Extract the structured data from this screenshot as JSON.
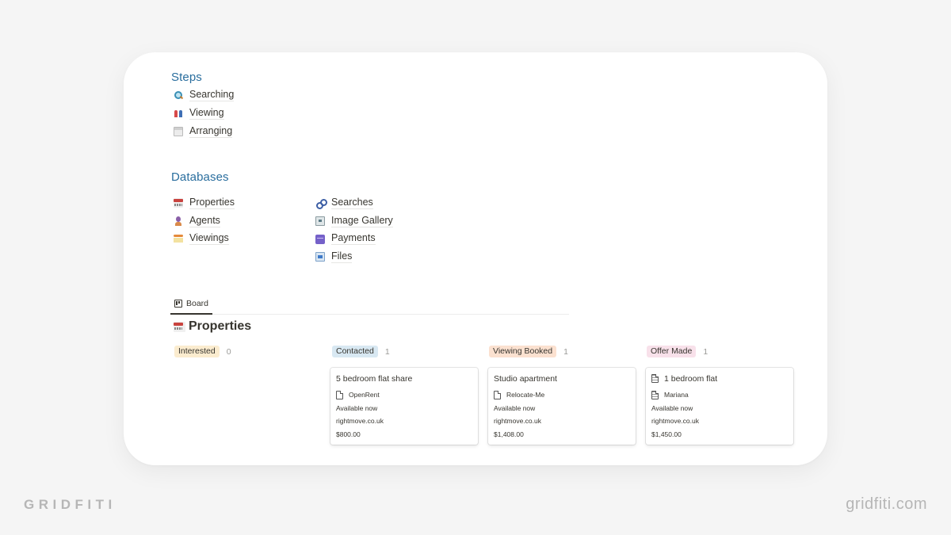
{
  "steps": {
    "heading": "Steps",
    "items": [
      {
        "label": "Searching",
        "icon": "magnifying-glass-icon"
      },
      {
        "label": "Viewing",
        "icon": "people-icon"
      },
      {
        "label": "Arranging",
        "icon": "calendar-icon"
      }
    ]
  },
  "databases": {
    "heading": "Databases",
    "left": [
      {
        "label": "Properties",
        "icon": "properties-icon"
      },
      {
        "label": "Agents",
        "icon": "agent-icon"
      },
      {
        "label": "Viewings",
        "icon": "viewings-icon"
      }
    ],
    "right": [
      {
        "label": "Searches",
        "icon": "link-icon"
      },
      {
        "label": "Image Gallery",
        "icon": "gallery-icon"
      },
      {
        "label": "Payments",
        "icon": "credit-card-icon"
      },
      {
        "label": "Files",
        "icon": "file-box-icon"
      }
    ]
  },
  "board": {
    "tab_label": "Board",
    "title": "Properties",
    "columns": [
      {
        "label": "Interested",
        "count": "0",
        "color": "#fbeccf",
        "cards": []
      },
      {
        "label": "Contacted",
        "count": "1",
        "color": "#d8e8f2",
        "cards": [
          {
            "title": "5 bedroom flat share",
            "agent": "OpenRent",
            "availability": "Available now",
            "source": "rightmove.co.uk",
            "price": "$800.00"
          }
        ]
      },
      {
        "label": "Viewing Booked",
        "count": "1",
        "color": "#fbe1d0",
        "cards": [
          {
            "title": "Studio apartment",
            "agent": "Relocate-Me",
            "availability": "Available now",
            "source": "rightmove.co.uk",
            "price": "$1,408.00"
          }
        ]
      },
      {
        "label": "Offer Made",
        "count": "1",
        "color": "#f8e1ea",
        "cards": [
          {
            "title": "1 bedroom flat",
            "agent": "Mariana",
            "availability": "Available now",
            "source": "rightmove.co.uk",
            "price": "$1,450.00"
          }
        ]
      }
    ]
  },
  "branding": {
    "left": "GRIDFITI",
    "right": "gridfiti.com"
  }
}
